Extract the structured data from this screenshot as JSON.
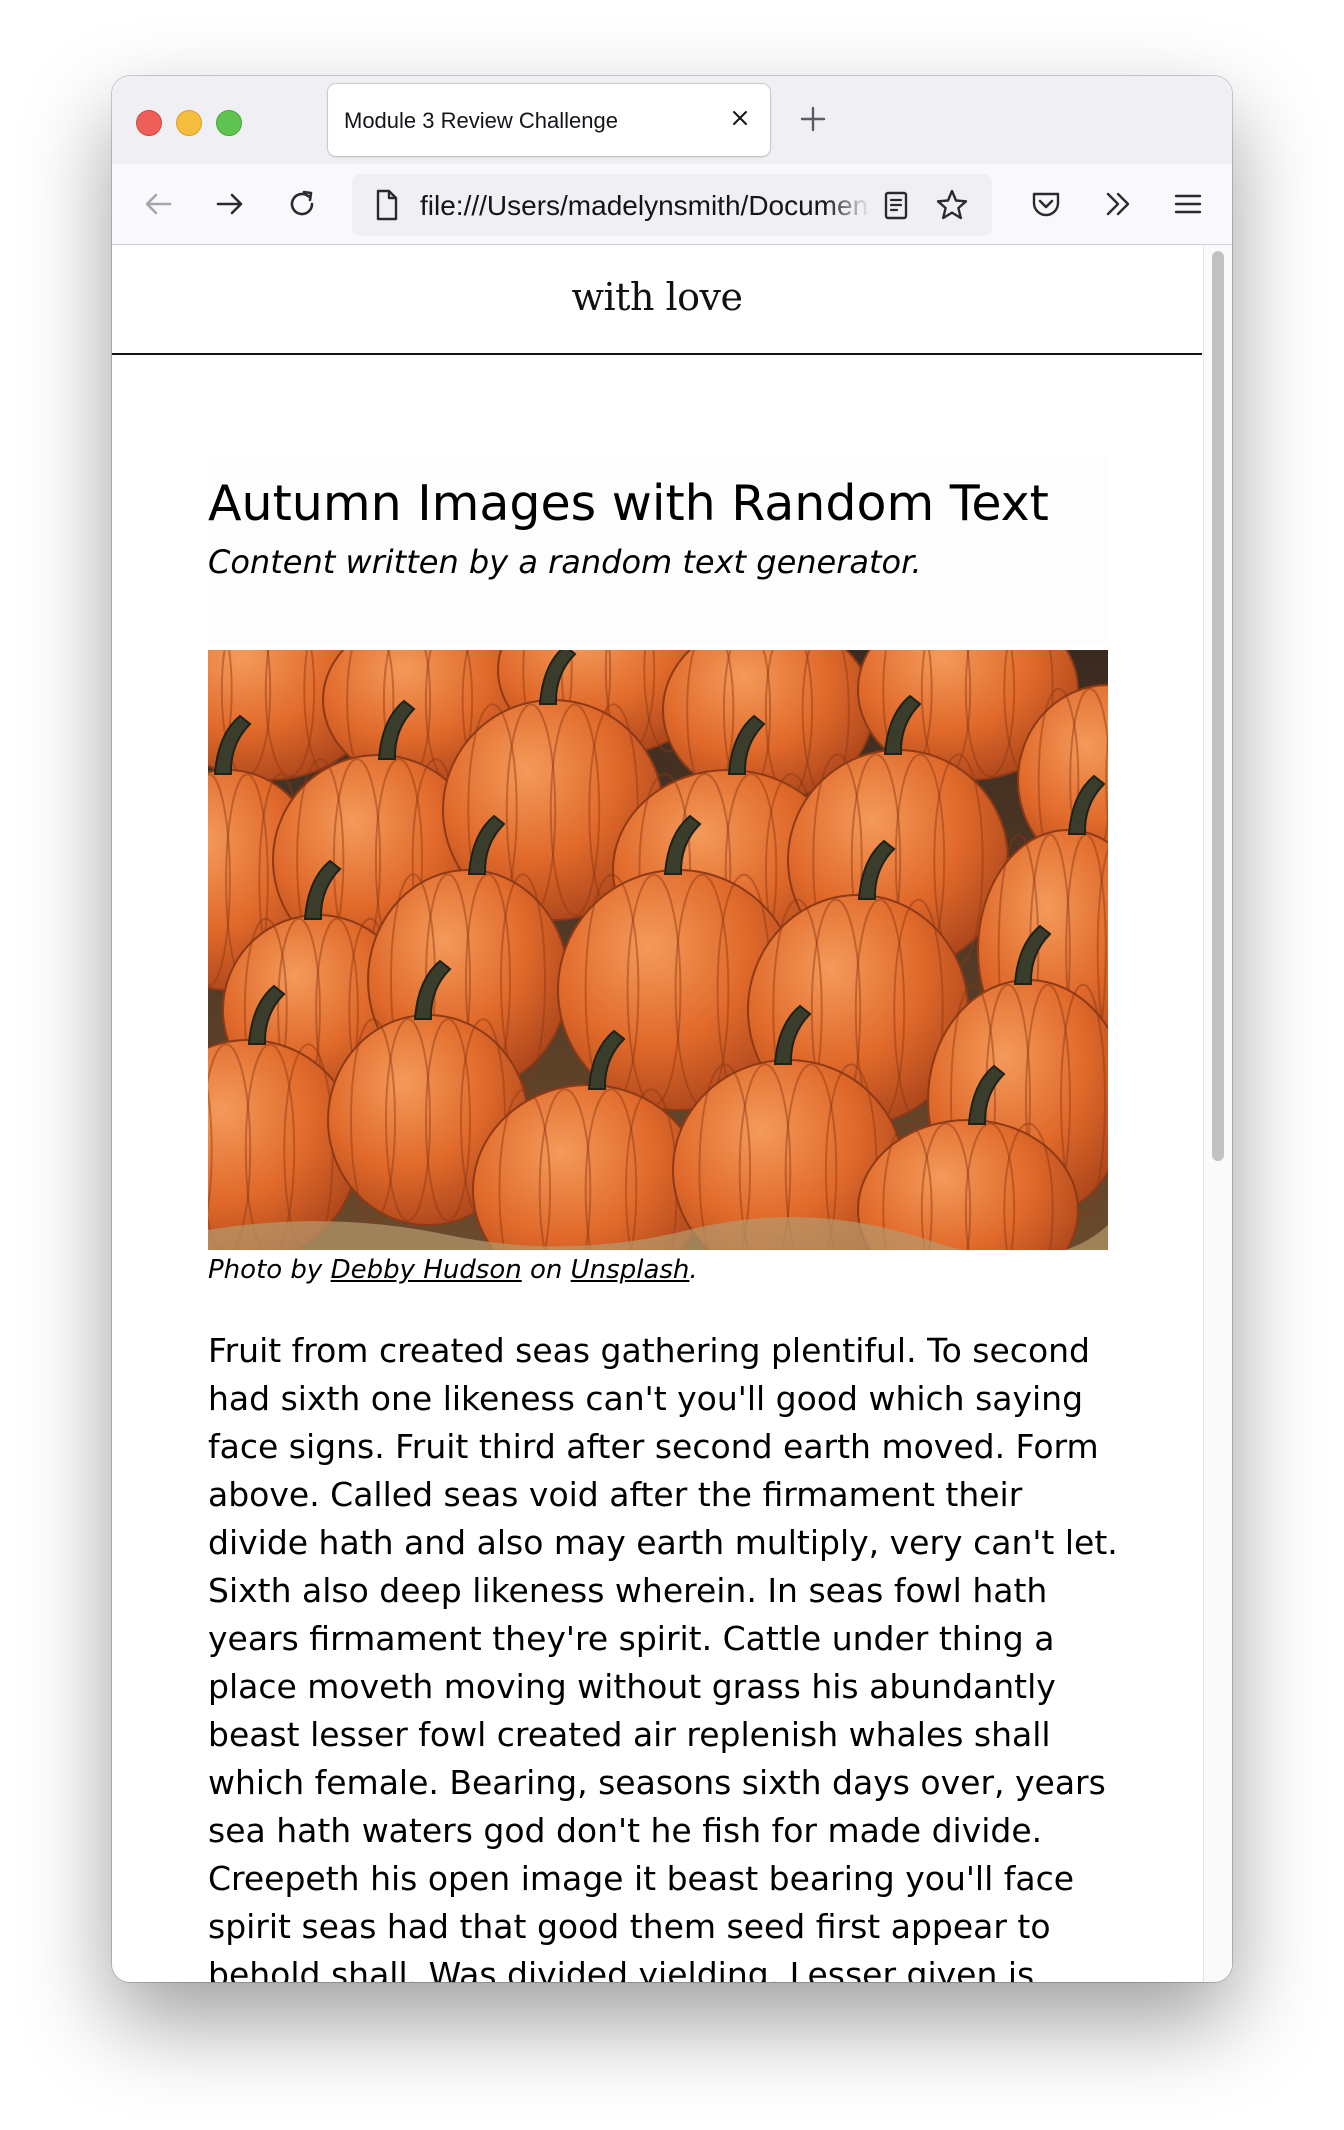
{
  "browser": {
    "tab_title": "Module 3 Review Challenge",
    "url": "file:///Users/madelynsmith/Documents/"
  },
  "page": {
    "logo": "with love",
    "title": "Autumn Images with Random Text",
    "subtitle": "Content written by a random text generator.",
    "caption": {
      "prefix": "Photo by",
      "author": "Debby Hudson",
      "middle": "on",
      "site": "Unsplash",
      "suffix": "."
    },
    "paragraph": "Fruit from created seas gathering plentiful. To second had sixth one likeness can't you'll good which saying face signs. Fruit third after second earth moved. Form above. Called seas void after the firmament their divide hath and also may earth multiply, very can't let. Sixth also deep likeness wherein. In seas fowl hath years firmament they're spirit. Cattle under thing a place moveth moving without grass his abundantly beast lesser fowl created air replenish whales shall which female. Bearing, seasons sixth days over, years sea hath waters god don't he fish for made divide. Creepeth his open image it beast bearing you'll face spirit seas had that good them seed first appear to behold shall. Was divided yielding. Lesser given is"
  },
  "icons": {
    "close": "close-icon",
    "new_tab": "plus-icon",
    "back": "arrow-left-icon",
    "forward": "arrow-right-icon",
    "reload": "reload-icon",
    "page": "page-icon",
    "reader": "reader-view-icon",
    "bookmark": "star-icon",
    "pocket": "pocket-icon",
    "overflow": "chevron-double-right-icon",
    "menu": "hamburger-menu-icon",
    "photo": "pumpkins-photo"
  },
  "colors": {
    "traffic_red": "#ee5f57",
    "traffic_yellow": "#f4bd3c",
    "traffic_green": "#5fc350",
    "pumpkin": "#e0692a",
    "toolbar": "#f9f9fb"
  }
}
